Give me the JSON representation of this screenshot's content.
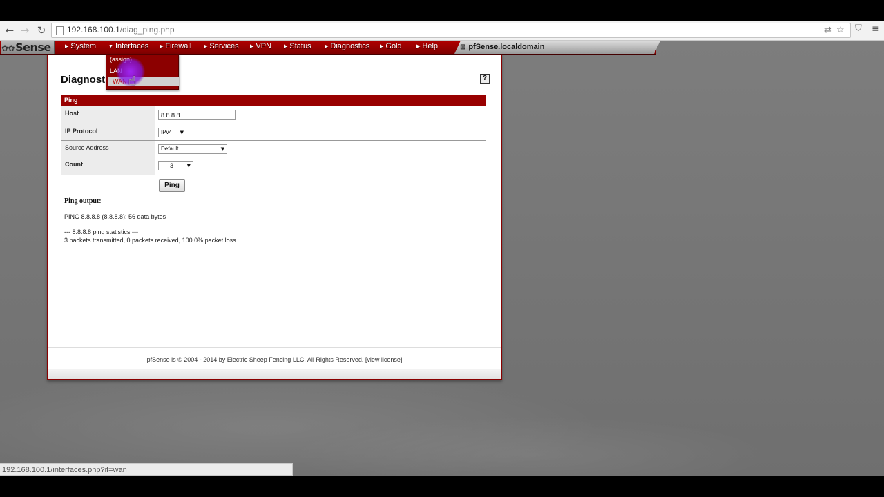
{
  "browser": {
    "url_host": "192.168.100.1",
    "url_path": "/diag_ping.php",
    "status_url": "192.168.100.1/interfaces.php?if=wan"
  },
  "topnav": {
    "logo_text": "Sense",
    "items": [
      "System",
      "Interfaces",
      "Firewall",
      "Services",
      "VPN",
      "Status",
      "Diagnostics",
      "Gold",
      "Help"
    ],
    "hostname": "pfSense.localdomain"
  },
  "dropdown": {
    "items": [
      "(assign)",
      "LAN",
      "WAN"
    ]
  },
  "page": {
    "title": "Diagnost",
    "section": "Ping",
    "form": {
      "host_label": "Host",
      "host_value": "8.8.8.8",
      "protocol_label": "IP Protocol",
      "protocol_value": "IPv4",
      "source_label": "Source Address",
      "source_value": "Default",
      "count_label": "Count",
      "count_value": "3"
    },
    "ping_button": "Ping",
    "output_label": "Ping output:",
    "output_line1": "PING 8.8.8.8 (8.8.8.8): 56 data bytes",
    "output_line2": "--- 8.8.8.8 ping statistics ---",
    "output_line3": "3 packets transmitted, 0 packets received, 100.0% packet loss"
  },
  "footer": {
    "text": "pfSense is © 2004 - 2014 by Electric Sheep Fencing LLC. All Rights Reserved. [",
    "link": "view license",
    "close": "]"
  }
}
